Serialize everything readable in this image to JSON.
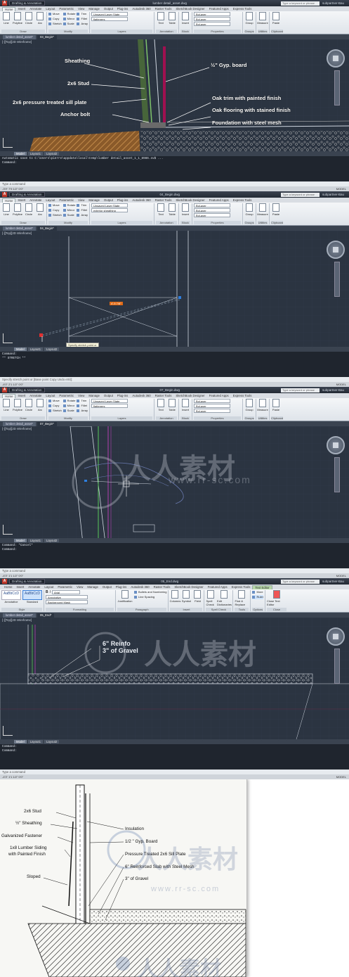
{
  "common": {
    "workspace": "Drafting & Annotation",
    "search_placeholder": "Type a keyword or phrase",
    "user": "subpartner-Bau",
    "tabs": [
      "Home",
      "Insert",
      "Annotate",
      "Layout",
      "Parametric",
      "View",
      "Manage",
      "Output",
      "Plug-ins",
      "Autodesk 360",
      "Raster Tools",
      "SketchBook Designer",
      "Featured Apps",
      "Express Tools"
    ],
    "draw_label": "Draw",
    "modify_label": "Modify",
    "layers_label": "Layers",
    "annotation_label": "Annotation",
    "block_label": "Block",
    "properties_label": "Properties",
    "groups_label": "Groups",
    "utilities_label": "Utilities",
    "clipboard_label": "Clipboard",
    "draw_buttons": [
      "Line",
      "Polyline",
      "Circle",
      "Arc"
    ],
    "modify_col1": [
      "Move",
      "Copy",
      "Stretch"
    ],
    "modify_col2": [
      "Rotate",
      "Mirror",
      "Scale"
    ],
    "modify_col3": [
      "Trim",
      "Fillet",
      "Array"
    ],
    "layer_state": "Unsaved Layer State",
    "bylayer": "ByLayer",
    "text_btn": "Text",
    "table_btn": "Table",
    "insert_btn": "Insert",
    "match_btn": "Match Properties",
    "group_btn": "Group",
    "measure_btn": "Measure",
    "paste_btn": "Paste",
    "viewport_label": "[-][Top][2D Wireframe]",
    "layout_tabs": [
      "Model",
      "Layout1",
      "Layout2"
    ],
    "command_placeholder": "Type a command",
    "model": "MODEL"
  },
  "panel1": {
    "doc_title": "lumber detail_asset.dwg",
    "doc_tabs": [
      "lumber detail_asset*",
      "03_Begin*"
    ],
    "layer_current": "flatteners",
    "annotations": {
      "sheathing": "Sheathing",
      "gyp": "½\" Gyp. board",
      "stud": "2x6 Stud",
      "sill": "2x6 pressure treated sill plate",
      "oak_trim": "Oak trim with painted finish",
      "anchor": "Anchor bolt",
      "oak_floor": "Oak flooring with stained finish",
      "foundation": "Foundation with steel mesh"
    },
    "command_history": "Automatic save to C:\\Users\\pierre\\appdata\\local\\temp\\lumber detail_asset_1_1_8986.sv$ ...",
    "command_line2": "Command:",
    "coords": "-3'9\"  7'9 1/2\"  0'0\""
  },
  "panel2": {
    "doc_title": "04_Begin.dwg",
    "doc_tabs": [
      "lumber detail_asset*",
      "04_Begin*"
    ],
    "layer_current": "exterior sheathing",
    "dim_value": "4'-5 7/8\"",
    "tooltip": "Specify stretch point or",
    "command_history": "Command:",
    "command_line2": "** STRETCH **",
    "prompt": "Specify stretch point or [Base point Copy Undo eXit]:",
    "coords": "-4'0\"  2'1 1/2\"  0'0\""
  },
  "panel3": {
    "doc_title": "07_Begin.dwg",
    "doc_tabs": [
      "lumber detail_asset*",
      "07_Begin*"
    ],
    "layer_current": "flatteners",
    "watermark_cn": "人人素材",
    "watermark_url": "www.rr-sc.com",
    "command_history": "Command: *Cancel*",
    "command_line2": "Command:",
    "coords": "-4'3\"  1'1 1/2\"  0'0\""
  },
  "panel4": {
    "doc_title": "05_End.dwg",
    "doc_tabs": [
      "lumber detail_asset*",
      "05_End*"
    ],
    "context_tab": "Text Editor",
    "style_items": [
      "AaBbCcD",
      "AaBbCcD"
    ],
    "style_captions": [
      "Annotative",
      "Standard"
    ],
    "style_label": "Style",
    "formatting_label": "Formatting",
    "paragraph_label": "Paragraph",
    "insert_label": "Insert",
    "spell_label": "Spell Check",
    "tools_label": "Tools",
    "options_label": "Options",
    "close_label": "Close",
    "font": "Arial",
    "annotative_btn": "Annotative",
    "bg_mask": "Background Mask",
    "justification": "Justification",
    "bullets": "Bullets and Numbering",
    "line_spacing": "Line Spacing",
    "columns": "Columns",
    "symbol": "Symbol",
    "field": "Field",
    "spell_check_btn": "Spell Check",
    "edit_dict": "Edit Dictionaries",
    "find_replace": "Find & Replace",
    "more": "More",
    "ruler": "Ruler",
    "close_editor": "Close Text Editor",
    "mtext_line1": "6\" Reinfo",
    "mtext_line2": "3\" of Gravel",
    "watermark_cn": "人人素材",
    "command_history": "Command:",
    "command_line2": "Command:",
    "coords": "-4'3\"  1'1 1/2\"  0'0\""
  },
  "paper": {
    "labels_left": [
      "2x6 Stud",
      "½\" Sheathing",
      "Galvanized Fastener",
      "1x8 Lumber Siding",
      "with Painted Finish",
      "Sloped"
    ],
    "labels_right": [
      "Insulation",
      "1/2 \" Gyp. Board",
      "Pressure Treated 2x6 Sill Plate",
      "6\" Reinforced Slab  with Steel Mesh",
      "3\" of Gravel"
    ],
    "watermark_cn": "人人素材",
    "watermark_url": "www.rr-sc.com"
  }
}
